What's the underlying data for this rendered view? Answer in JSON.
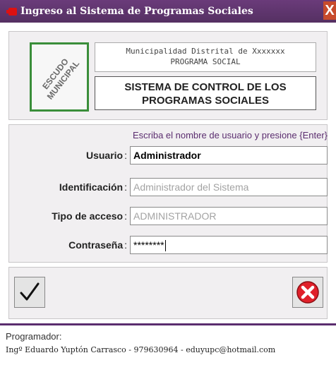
{
  "window": {
    "title": "Ingreso al Sistema de Programas Sociales",
    "close_glyph": "X",
    "icon": "app-window-icon"
  },
  "header": {
    "logo_text": "ESCUDO MUNICIPAL",
    "municipality": "Municipalidad Distrital de Xxxxxxx",
    "program": "PROGRAMA SOCIAL",
    "system_title": "SISTEMA DE CONTROL DE LOS PROGRAMAS SOCIALES"
  },
  "form": {
    "hint": "Escriba el nombre de usuario y presione {Enter}",
    "usuario": {
      "label": "Usuario",
      "value": "Administrador"
    },
    "identificacion": {
      "label": "Identificación",
      "value": "Administrador del Sistema"
    },
    "tipo_acceso": {
      "label": "Tipo de acceso",
      "value": "ADMINISTRADOR"
    },
    "contrasena": {
      "label": "Contraseña",
      "value": "********"
    },
    "colon": ":"
  },
  "buttons": {
    "ok_icon": "checkmark-icon",
    "cancel_icon": "cancel-x-icon"
  },
  "footer": {
    "title": "Programador:",
    "credit": "Ingº Eduardo Yuptón Carrasco - 979630964 - eduyupc@hotmail.com"
  },
  "colors": {
    "titlebar": "#5b2d6f",
    "accent": "#5b2d6f",
    "logo_border": "#3a8e3a",
    "cancel_red": "#e0202a"
  }
}
